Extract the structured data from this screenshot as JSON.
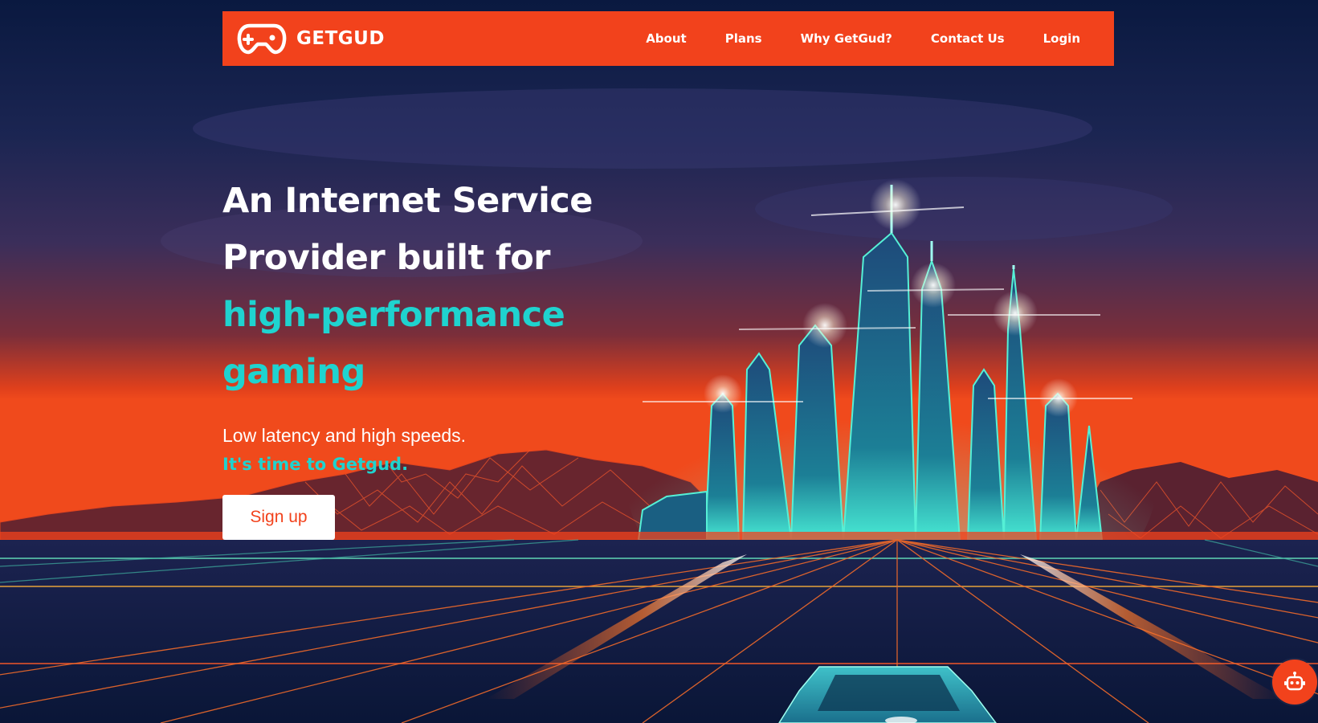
{
  "brand": {
    "name": "GETGUD",
    "icon": "gamepad-icon"
  },
  "nav": {
    "items": [
      {
        "label": "About"
      },
      {
        "label": "Plans"
      },
      {
        "label": "Why GetGud?"
      },
      {
        "label": "Contact Us"
      },
      {
        "label": "Login"
      }
    ]
  },
  "hero": {
    "title_line1": "An Internet Service",
    "title_line2": "Provider built for",
    "title_accent_line1": "high-performance",
    "title_accent_line2": "gaming",
    "tagline": "Low latency and high speeds.",
    "cta_text": "It's time to Getgud.",
    "signup_label": "Sign up"
  },
  "chat": {
    "icon": "robot-icon"
  },
  "colors": {
    "brand_orange": "#f2421c",
    "accent_teal": "#1fd3cf",
    "background_navy": "#0b1a3f"
  }
}
